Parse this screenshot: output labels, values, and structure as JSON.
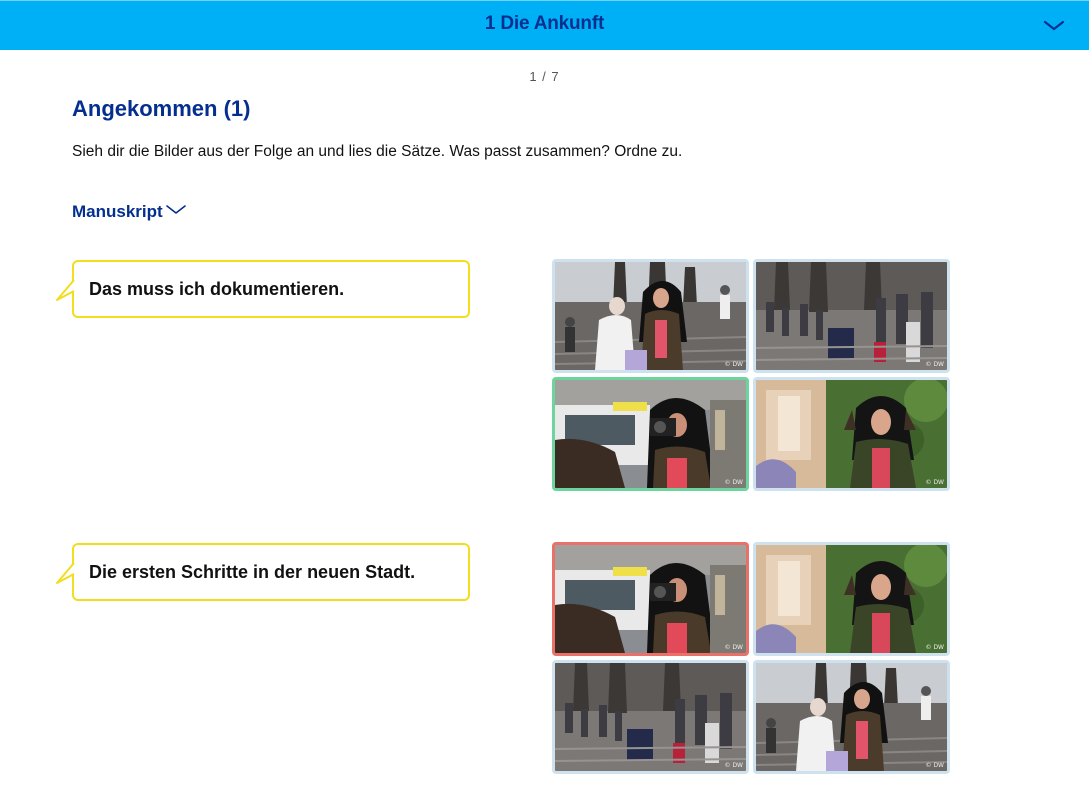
{
  "header": {
    "title": "1 Die Ankunft",
    "chevron_icon": "chevron-down-icon"
  },
  "pager": {
    "text": "1 / 7"
  },
  "exercise": {
    "title": "Angekommen (1)",
    "instructions": "Sieh dir die Bilder aus der Folge an und lies die Sätze. Was passt zusammen? Ordne zu.",
    "manuscript_label": "Manuskript"
  },
  "items": [
    {
      "sentence": "Das muss ich dokumentieren.",
      "tiles": [
        {
          "scene": "woman-with-old-man-on-stairs",
          "state": "neutral"
        },
        {
          "scene": "crowd-on-stairs-at-cathedral",
          "state": "neutral"
        },
        {
          "scene": "woman-taking-photo-at-taxi",
          "state": "correct"
        },
        {
          "scene": "woman-holding-head-at-building",
          "state": "neutral"
        }
      ]
    },
    {
      "sentence": "Die ersten Schritte in der neuen Stadt.",
      "tiles": [
        {
          "scene": "woman-taking-photo-at-taxi",
          "state": "wrong"
        },
        {
          "scene": "woman-holding-head-at-building",
          "state": "neutral"
        },
        {
          "scene": "crowd-on-stairs-at-cathedral",
          "state": "neutral"
        },
        {
          "scene": "woman-with-old-man-on-stairs",
          "state": "neutral"
        }
      ]
    }
  ],
  "watermark": "© DW",
  "colors": {
    "header_bg": "#00b0f7",
    "heading": "#052f8f",
    "bubble_border": "#f2dd1f",
    "tile_border": "#cde2ee",
    "correct": "#6cd49c",
    "wrong": "#e8716a"
  }
}
